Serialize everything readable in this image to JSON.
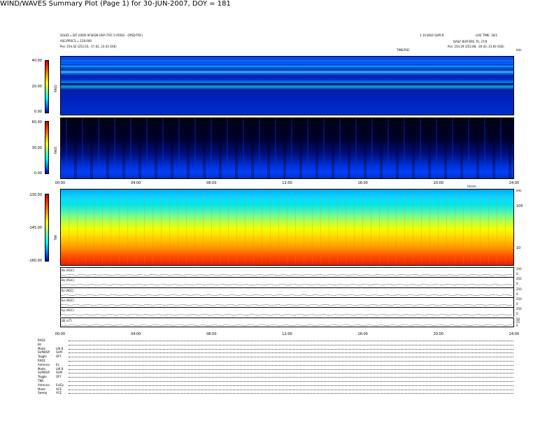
{
  "header": {
    "title": "WIND/WAVES Summary Plot (Page 1) for 30-JUN-2007, DOY = 181",
    "left_line1": "SOLID = BIT (0000 0FSEDR-OSP (TOC 0 POSS) - OPSD-TRC)",
    "left_line2": "ASC/PRSCS = 129.000",
    "left_line3": "Pos:   254.42 (252.03, -17.62, 23.43 GSE)",
    "right_line1": "LIVE TIME: 30/1",
    "right_line2": "1.10 WSO SUPCR",
    "right_line3": "DAILY BUFFERS 70, 27/0",
    "right_line4": "Pos:   254.29 (252.88, -20.43, 23.83 GSE)",
    "mid_tag": "TIME/RSC",
    "corner_tag": "kHz"
  },
  "panels": {
    "rad2": {
      "name": "RAD2",
      "ticks": [
        "40.00",
        "20.00",
        "0.00"
      ]
    },
    "rad1": {
      "name": "RAD1",
      "ticks": [
        "60.00",
        "30.00",
        "0.00"
      ]
    },
    "tnr": {
      "name": "TNR",
      "ticks": [
        "-130.00",
        "-145.00",
        "-160.00"
      ],
      "right_ticks": [
        "100",
        "10"
      ],
      "right_label": "kHz"
    }
  },
  "time_axis": {
    "labels": [
      "00:00",
      "04:00",
      "08:00",
      "12:00",
      "16:00",
      "20:00",
      "24:00"
    ],
    "unit": "hhmm"
  },
  "housekeeping": [
    {
      "label": "Bx (AGC)",
      "right": [
        "250",
        "0"
      ]
    },
    {
      "label": "By (AGC)",
      "right": [
        "250",
        "0"
      ]
    },
    {
      "label": "Ez (AGC)",
      "right": [
        "250",
        "0"
      ]
    },
    {
      "label": "Ex (AGC)",
      "right": [
        "250",
        "0"
      ]
    },
    {
      "label": "Ey (AGC)",
      "right": [
        "250",
        "0"
      ]
    },
    {
      "label": "|B| (nT)",
      "right": [
        "50",
        "25",
        "0"
      ]
    }
  ],
  "footer": [
    {
      "k": "RAD2",
      "v": ""
    },
    {
      "k": "Bz",
      "v": ""
    },
    {
      "k": "Mode",
      "v": "LIN B"
    },
    {
      "k": "SUMDSP",
      "v": "SUM"
    },
    {
      "k": "Toggle",
      "v": "OFF"
    },
    {
      "k": "RAD1",
      "v": ""
    },
    {
      "k": "Antenna",
      "v": "Ex"
    },
    {
      "k": "Mode",
      "v": "LIN B"
    },
    {
      "k": "SUMDSP",
      "v": "SUM"
    },
    {
      "k": "Toggle",
      "v": "OFF"
    },
    {
      "k": "TNR",
      "v": ""
    },
    {
      "k": "Antenna",
      "v": "Ex/Ey"
    },
    {
      "k": "Mode",
      "v": "ACE"
    },
    {
      "k": "Sweep",
      "v": "ACE"
    }
  ],
  "chart_data": [
    {
      "type": "heatmap",
      "name": "RAD2",
      "x_range": [
        "00:00",
        "24:00"
      ],
      "colorbar_ticks": [
        40.0,
        20.0,
        0.0
      ]
    },
    {
      "type": "heatmap",
      "name": "RAD1",
      "x_range": [
        "00:00",
        "24:00"
      ],
      "colorbar_ticks": [
        60.0,
        30.0,
        0.0
      ]
    },
    {
      "type": "heatmap",
      "name": "TNR",
      "x_range": [
        "00:00",
        "24:00"
      ],
      "colorbar_ticks": [
        -130.0,
        -145.0,
        -160.0
      ],
      "y_ticks_right": [
        100,
        10
      ],
      "y_unit": "kHz"
    },
    {
      "type": "line",
      "name": "housekeeping",
      "x": [
        "00:00",
        "04:00",
        "08:00",
        "12:00",
        "16:00",
        "20:00",
        "24:00"
      ]
    }
  ]
}
